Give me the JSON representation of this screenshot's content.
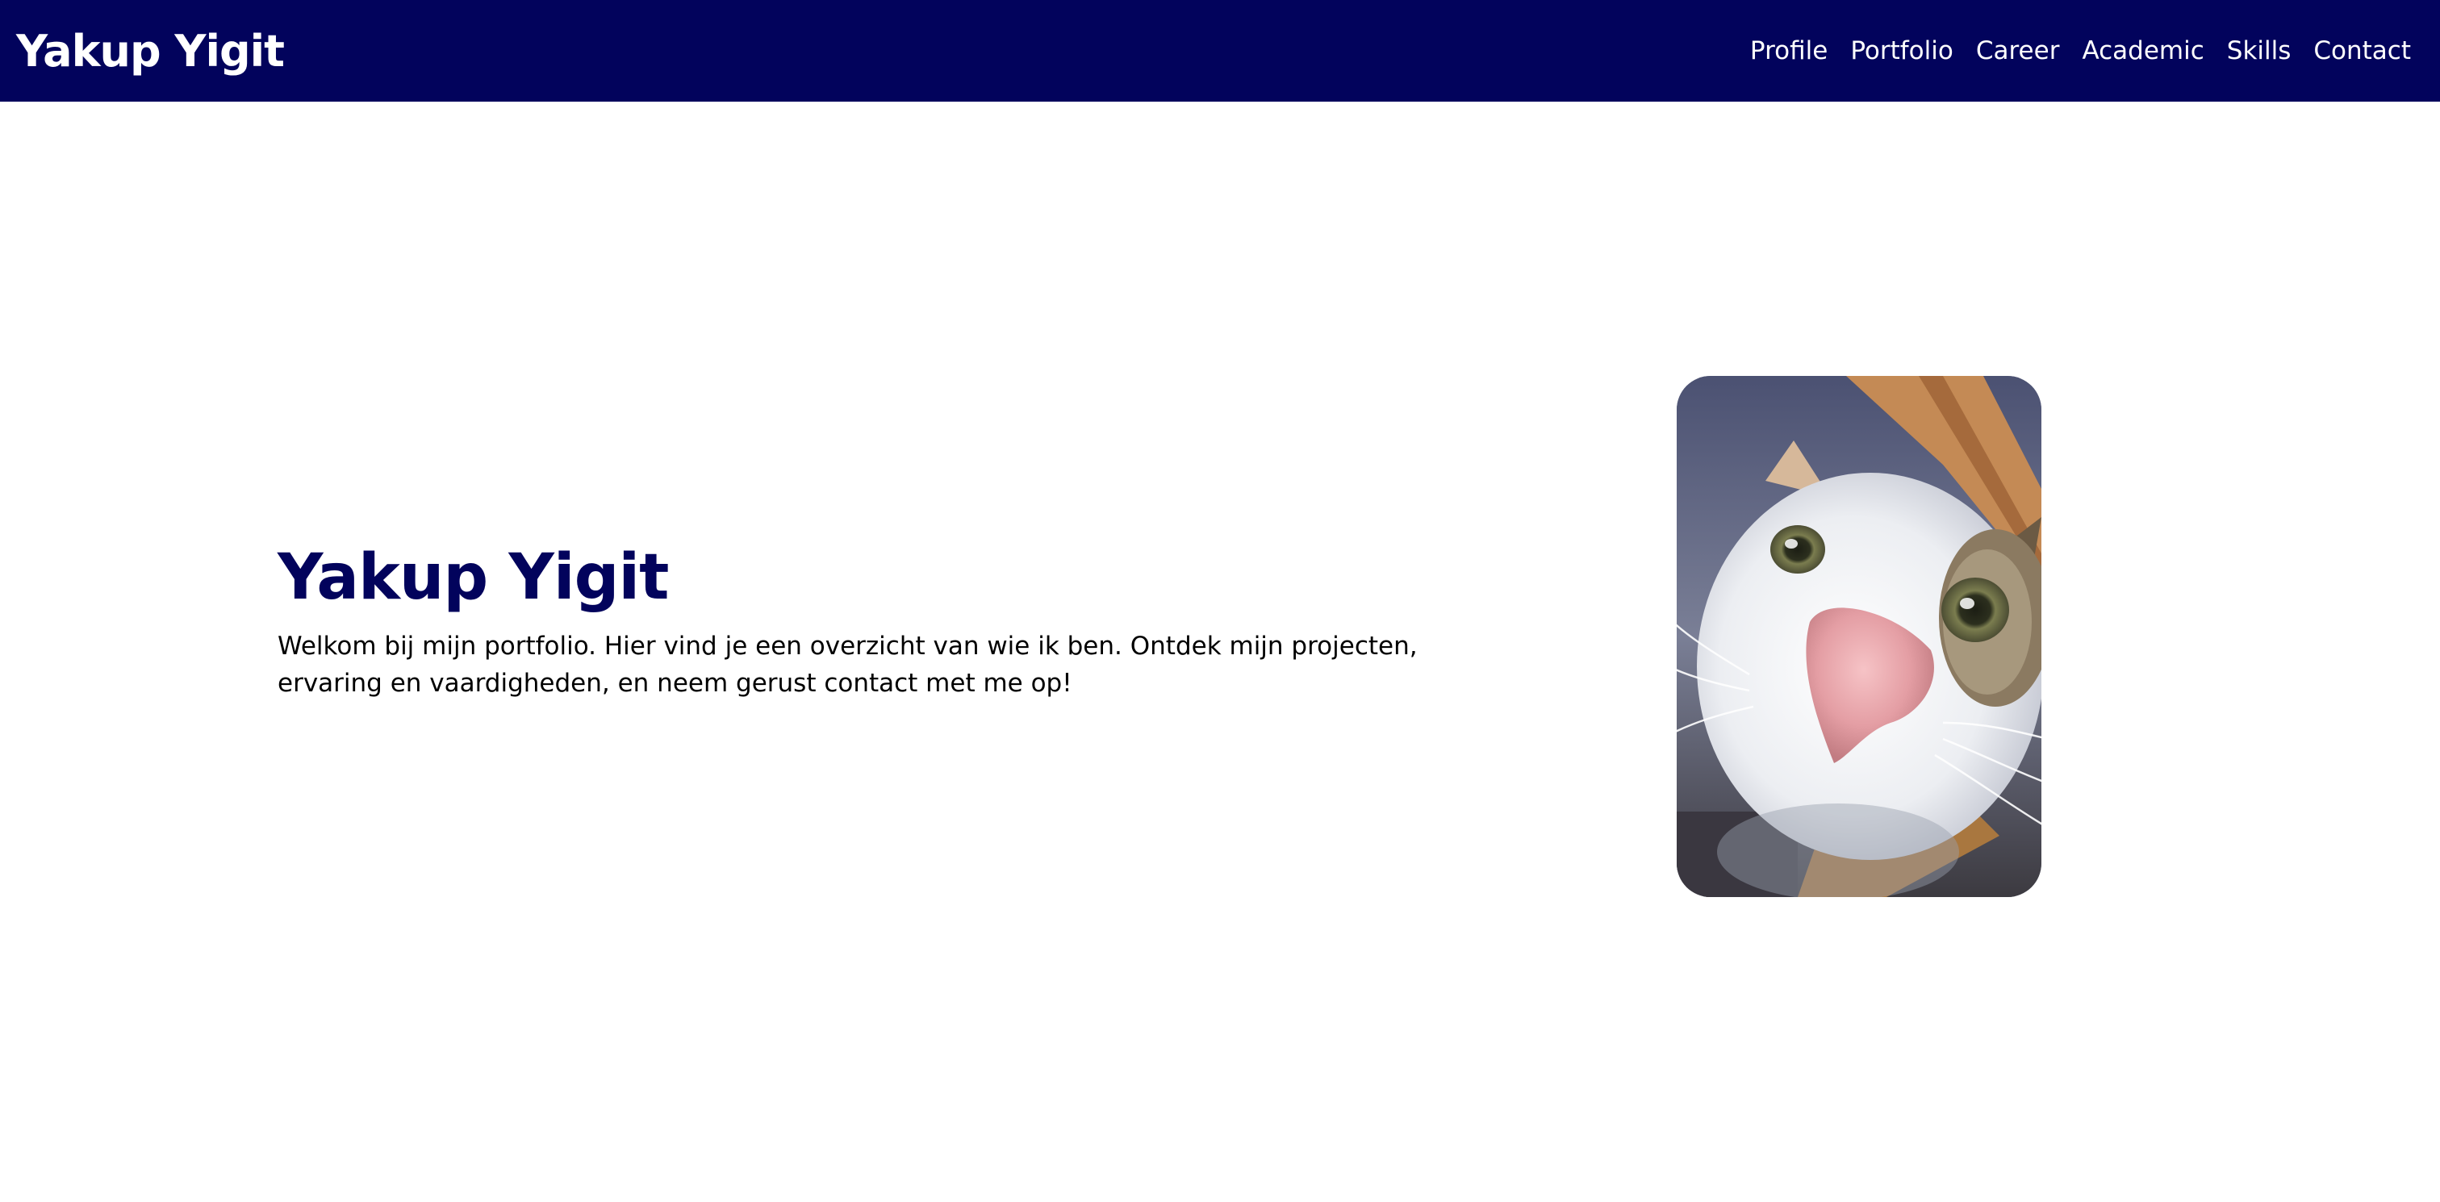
{
  "header": {
    "brand": "Yakup Yigit",
    "nav": [
      {
        "label": "Profile"
      },
      {
        "label": "Portfolio"
      },
      {
        "label": "Career"
      },
      {
        "label": "Academic"
      },
      {
        "label": "Skills"
      },
      {
        "label": "Contact"
      }
    ],
    "background_color": "#02035c"
  },
  "hero": {
    "title": "Yakup Yigit",
    "intro": "Welkom bij mijn portfolio. Hier vind je een overzicht van wie ik ben. Ontdek mijn projecten, ervaring en vaardigheden, en neem gerust contact met me op!",
    "title_color": "#02035c"
  },
  "profile_photo": {
    "subject": "close-up photo of a white and tabby cat"
  }
}
